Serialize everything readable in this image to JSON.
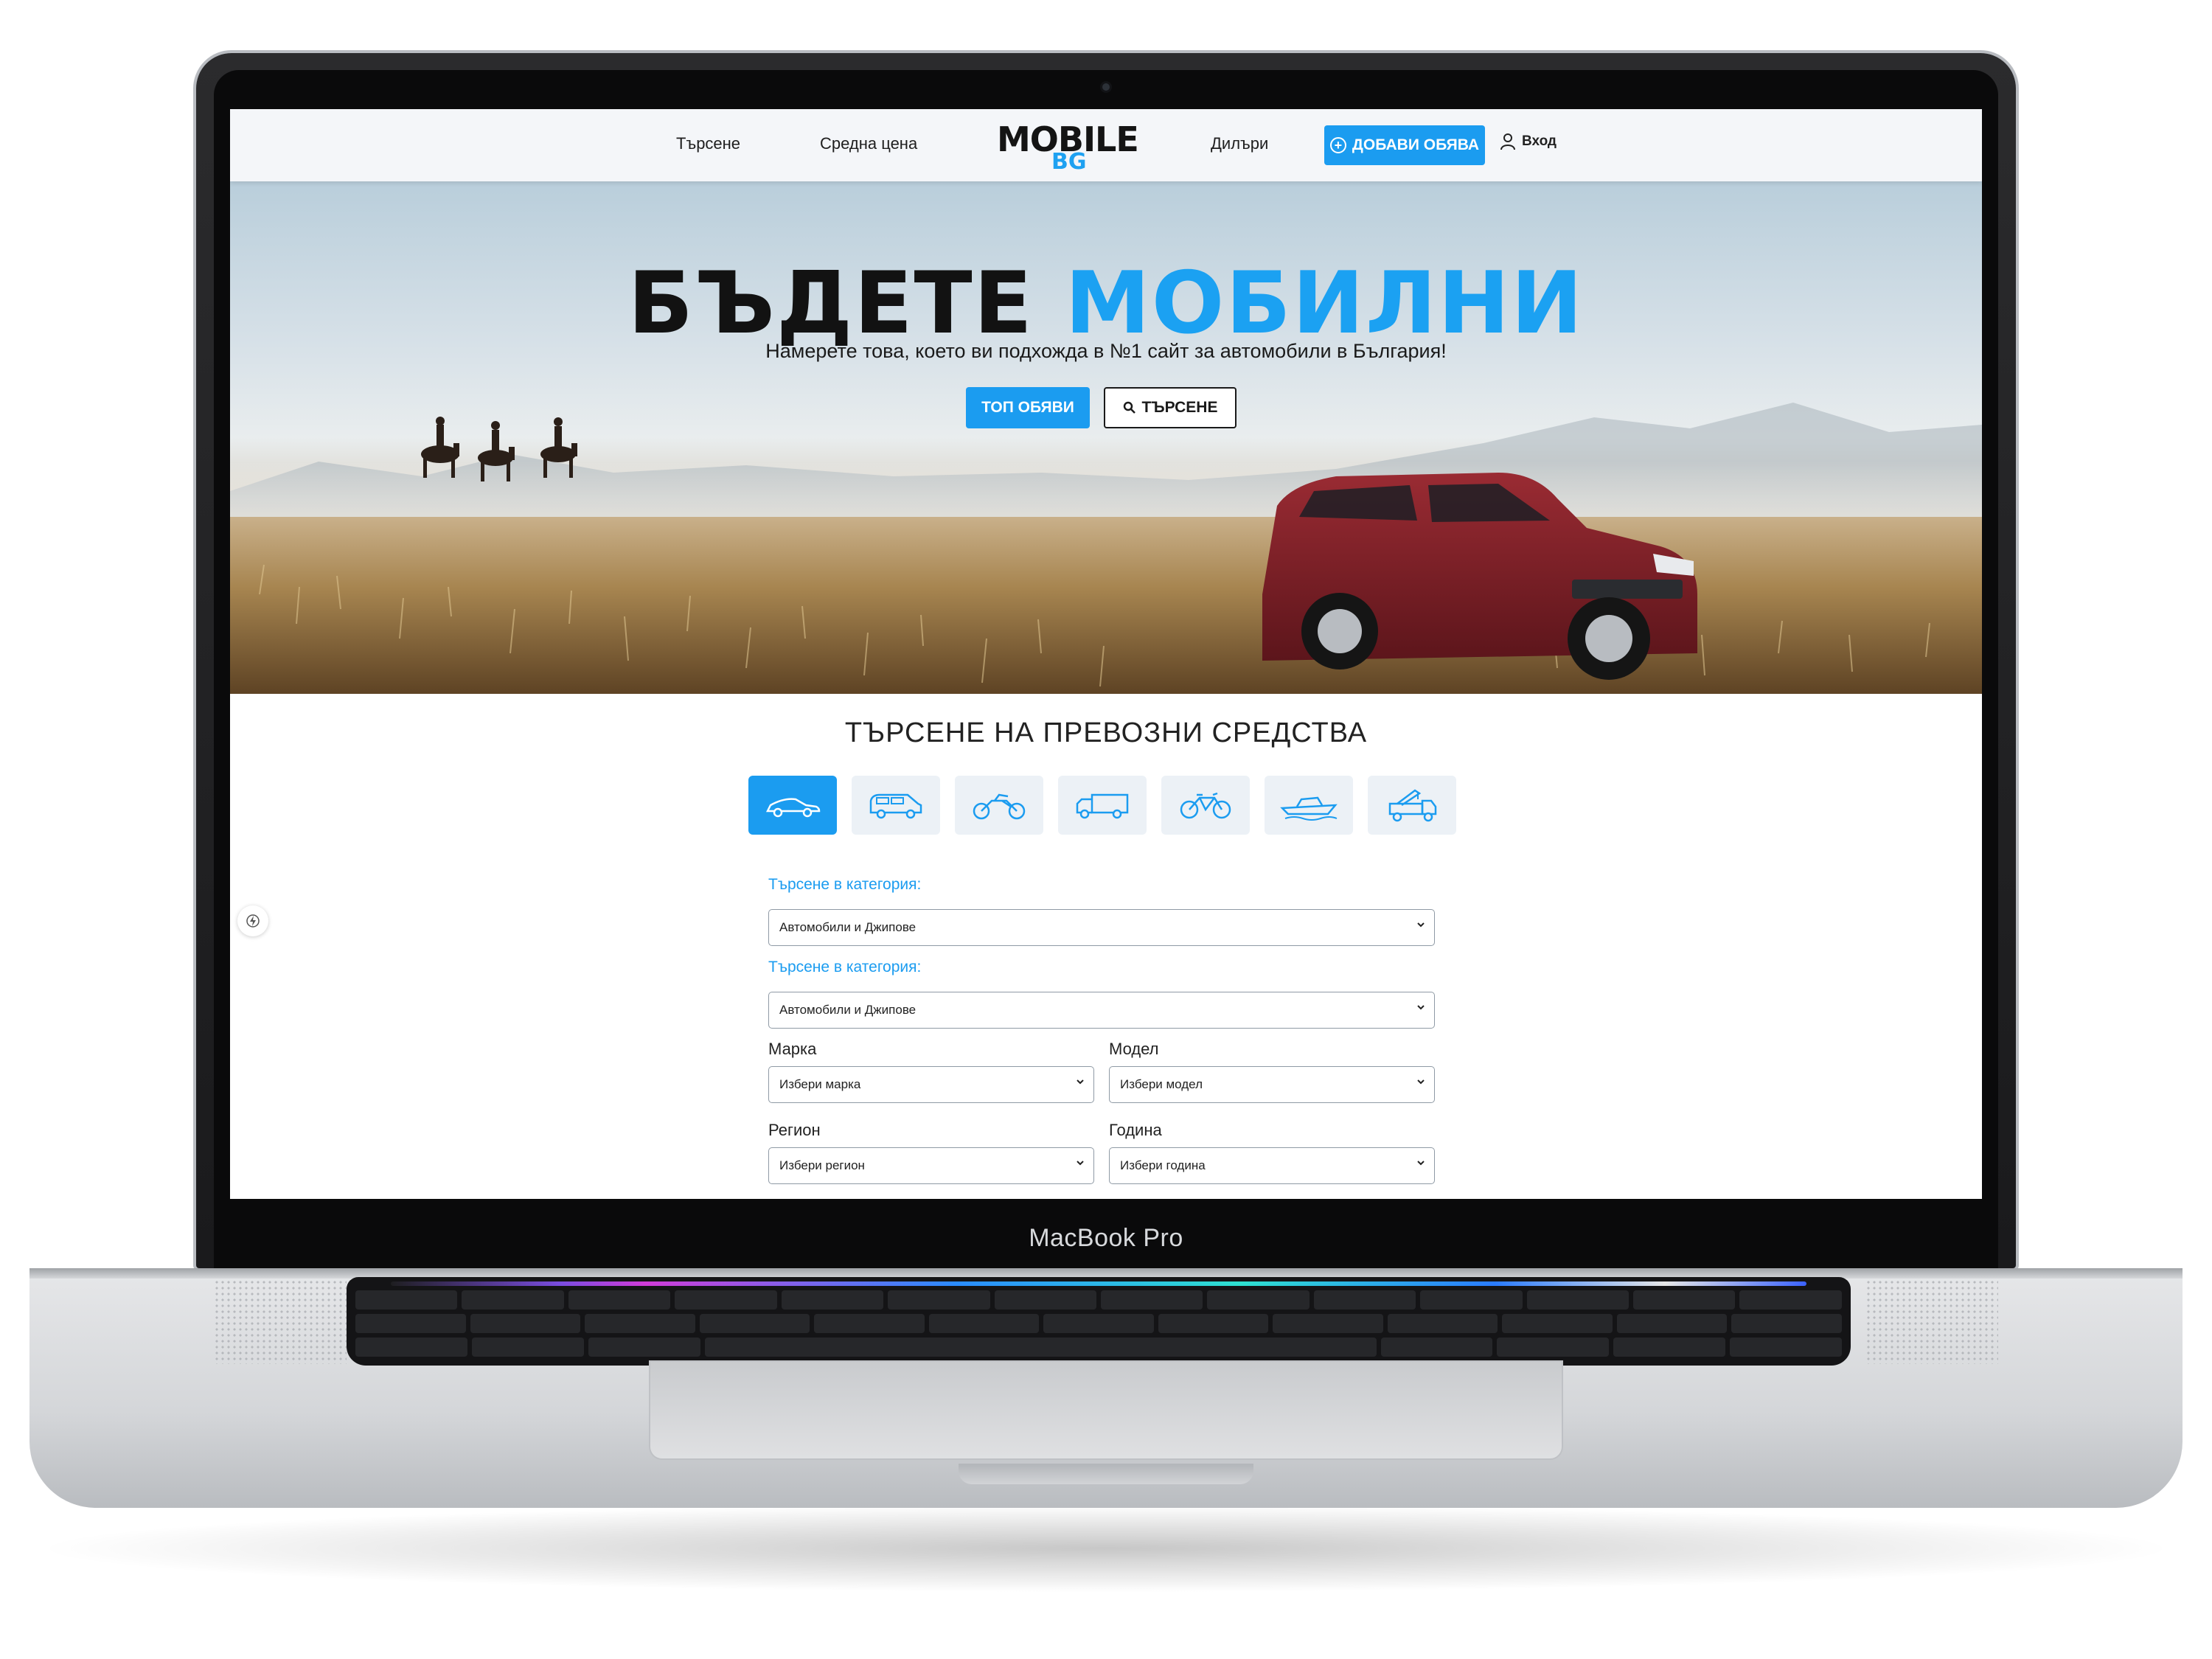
{
  "device": {
    "label": "MacBook Pro"
  },
  "header": {
    "nav": {
      "search": "Търсене",
      "average_price": "Средна цена",
      "dealers": "Дилъри"
    },
    "logo": {
      "line1": "MOBILE",
      "line2": "BG"
    },
    "add_listing": "ДОБАВИ ОБЯВА",
    "login": "Вход"
  },
  "hero": {
    "title_part1": "БЪДЕТЕ",
    "title_part2": "МОБИЛНИ",
    "subtitle": "Намерете това, което ви подхожда в №1 сайт за автомобили в България!",
    "btn_top": "ТОП ОБЯВИ",
    "btn_search": "ТЪРСЕНЕ"
  },
  "vehicle_search": {
    "title": "ТЪРСЕНЕ НА ПРЕВОЗНИ СРЕДСТВА",
    "tabs": [
      "car-icon",
      "van-icon",
      "motorcycle-icon",
      "truck-icon",
      "bicycle-icon",
      "boat-icon",
      "crane-truck-icon"
    ],
    "active_tab": "car-icon"
  },
  "form": {
    "category1_label": "Търсене в категория:",
    "category1_value": "Автомобили и Джипове",
    "category2_label": "Търсене в категория:",
    "category2_value": "Автомобили и Джипове",
    "brand_label": "Марка",
    "brand_value": "Избери марка",
    "model_label": "Модел",
    "model_value": "Избери модел",
    "region_label": "Регион",
    "region_value": "Избери регион",
    "year_label": "Година",
    "year_value": "Избери година"
  },
  "colors": {
    "accent": "#1b9cf0",
    "dark": "#121212",
    "car_body": "#7c1f26"
  }
}
